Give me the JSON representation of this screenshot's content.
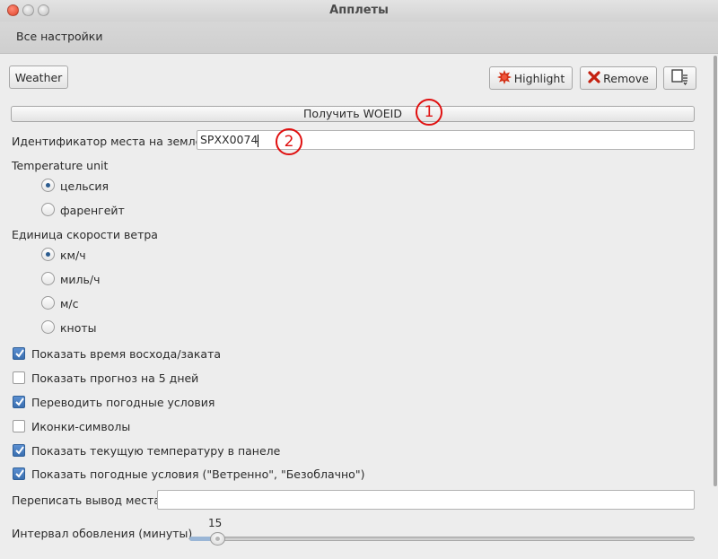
{
  "window": {
    "title": "Апплеты"
  },
  "menu": {
    "all_settings": "Все настройки"
  },
  "toolbar": {
    "applet_name": "Weather",
    "highlight_label": "Highlight",
    "remove_label": "Remove"
  },
  "woeid": {
    "get_button_label": "Получить WOEID",
    "location_label": "Идентификатор места на земле",
    "location_value": "SPXX0074"
  },
  "annotations": {
    "marker1": "1",
    "marker2": "2",
    "color": "#e01010"
  },
  "temperature": {
    "heading": "Temperature unit",
    "options": [
      {
        "label": "цельсия",
        "selected": true
      },
      {
        "label": "фаренгейт",
        "selected": false
      }
    ]
  },
  "wind": {
    "heading": "Единица скорости ветра",
    "options": [
      {
        "label": "км/ч",
        "selected": true
      },
      {
        "label": "миль/ч",
        "selected": false
      },
      {
        "label": "м/с",
        "selected": false
      },
      {
        "label": "кноты",
        "selected": false
      }
    ]
  },
  "checkboxes": [
    {
      "label": "Показать время восхода/заката",
      "checked": true
    },
    {
      "label": "Показать прогноз на 5 дней",
      "checked": false
    },
    {
      "label": "Переводить погодные условия",
      "checked": true
    },
    {
      "label": "Иконки-символы",
      "checked": false
    },
    {
      "label": "Показать текущую температуру в панеле",
      "checked": true
    },
    {
      "label": "Показать погодные условия (\"Ветренно\", \"Безоблачно\")",
      "checked": true
    }
  ],
  "override": {
    "label": "Переписать вывод места",
    "value": ""
  },
  "refresh": {
    "label": "Интервал обовления (минуты)",
    "value_text": "15",
    "value": 15,
    "min": 10,
    "max": 1440
  },
  "colors": {
    "accent": "#3a6fb0",
    "window_bg": "#ececec"
  }
}
